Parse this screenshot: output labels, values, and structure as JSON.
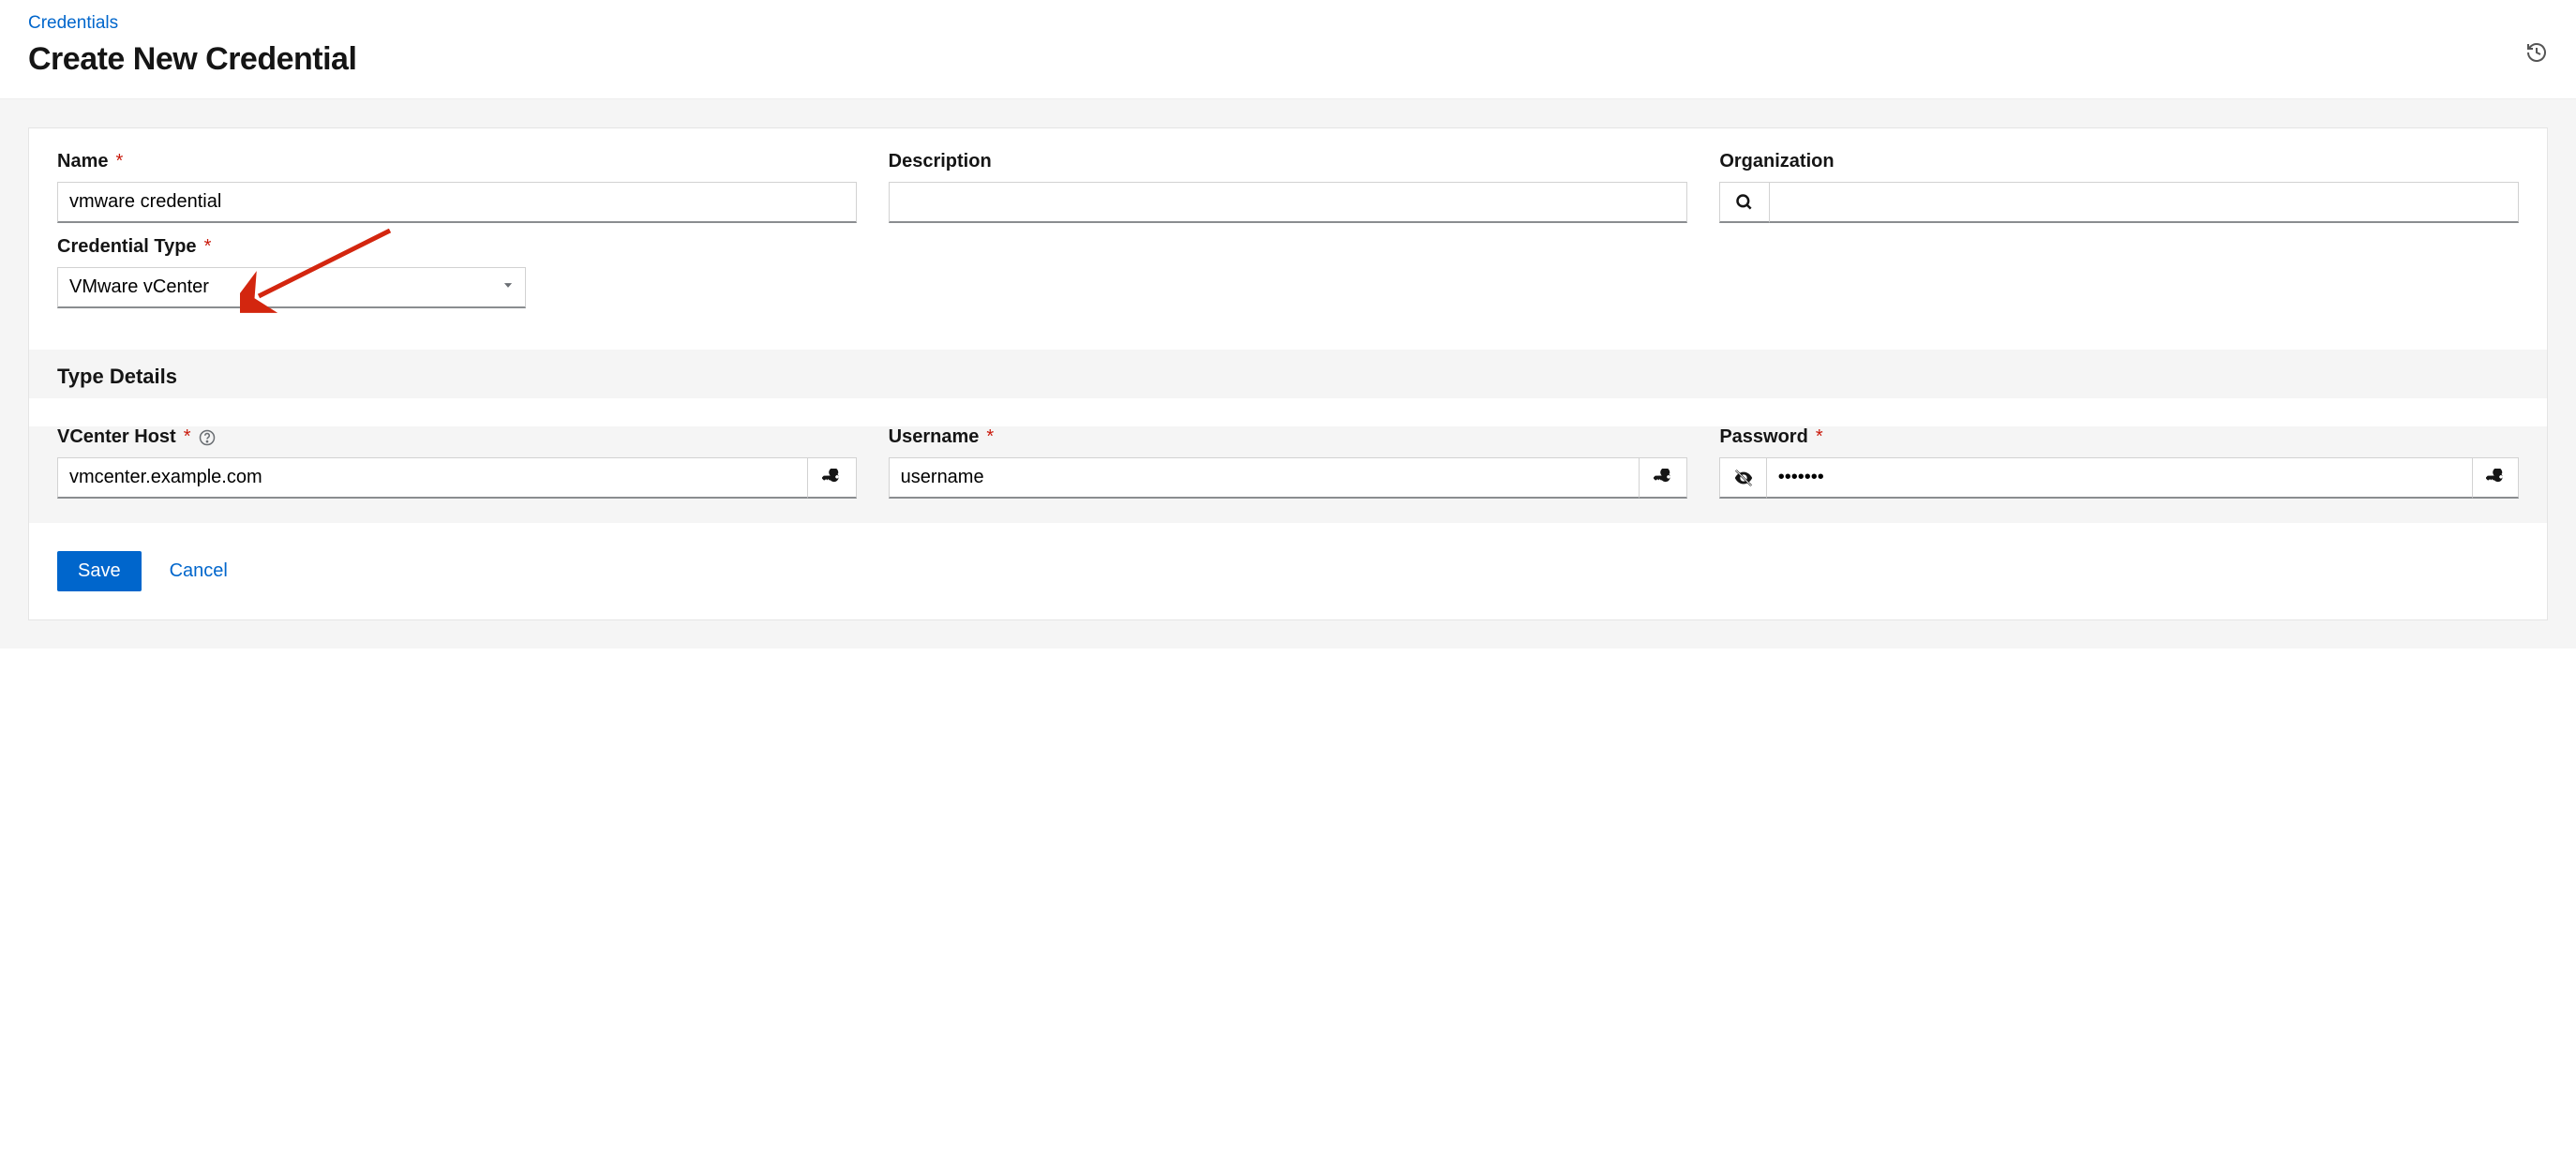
{
  "breadcrumb": {
    "label": "Credentials"
  },
  "page_title": "Create New Credential",
  "labels": {
    "name": "Name",
    "description": "Description",
    "organization": "Organization",
    "credential_type": "Credential Type",
    "type_details": "Type Details",
    "vcenter_host": "VCenter Host",
    "username": "Username",
    "password": "Password"
  },
  "values": {
    "name": "vmware credential",
    "description": "",
    "organization": "",
    "credential_type": "VMware vCenter",
    "vcenter_host": "vmcenter.example.com",
    "username": "username",
    "password": "•••••••"
  },
  "buttons": {
    "save": "Save",
    "cancel": "Cancel"
  },
  "colors": {
    "primary": "#0066cc",
    "required": "#c9190b",
    "arrow": "#d3260f"
  }
}
